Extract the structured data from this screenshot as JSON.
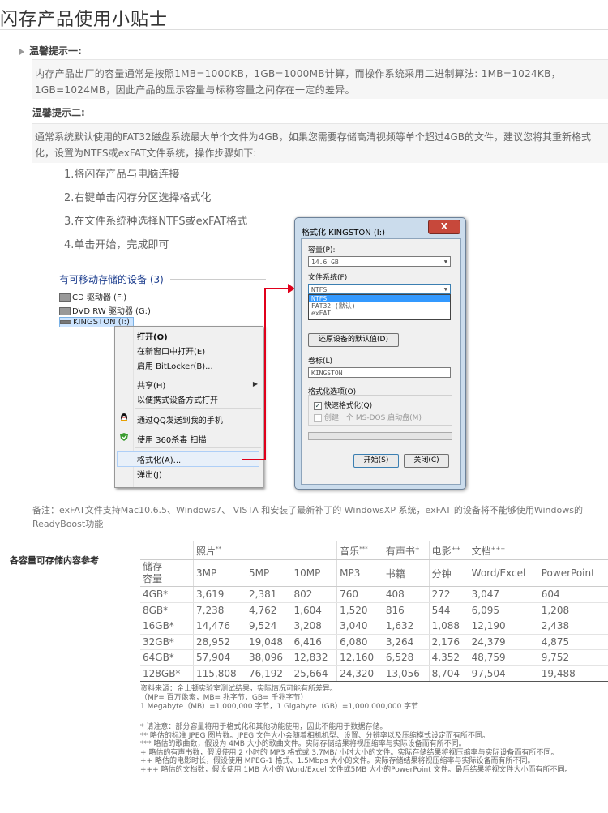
{
  "page": {
    "title": "闪存产品使用小贴士",
    "tip1_heading": "温馨提示一:",
    "tip1_text": "内存产品出厂的容量通常是按照1MB=1000KB，1GB=1000MB计算，而操作系统采用二进制算法: 1MB=1024KB，1GB=1024MB，因此产品的显示容量与标称容量之间存在一定的差异。",
    "tip2_heading": "温馨提示二:",
    "tip2_text": "通常系统默认使用的FAT32磁盘系统最大单个文件为4GB，如果您需要存储高清视频等单个超过4GB的文件，建议您将其重新格式化，设置为NTFS或exFAT文件系统，操作步骤如下:",
    "steps": [
      "1.将闪存产品与电脑连接",
      "2.右键单击闪存分区选择格式化",
      "3.在文件系统种选择NTFS或exFAT格式",
      "4.单击开始，完成即可"
    ]
  },
  "explorer": {
    "group_title": "有可移动存储的设备 (3)",
    "drives": [
      "CD 驱动器 (F:)",
      "DVD RW 驱动器 (G:)",
      "KINGSTON (I:)"
    ],
    "menu": {
      "open": "打开(O)",
      "open_new": "在新窗口中打开(E)",
      "bitlocker": "启用 BitLocker(B)...",
      "share": "共享(H)",
      "portable": "以便携式设备方式打开",
      "qq": "通过QQ发送到我的手机",
      "scan360": "使用 360杀毒 扫描",
      "format": "格式化(A)...",
      "eject": "弹出(J)"
    }
  },
  "dialog": {
    "title": "格式化 KINGSTON (I:)",
    "close": "X",
    "capacity_label": "容量(P):",
    "capacity_value": "14.6 GB",
    "fs_label": "文件系统(F)",
    "fs_value": "NTFS",
    "fs_options": [
      "NTFS",
      "FAT32 (默认)",
      "exFAT"
    ],
    "restore_button": "还原设备的默认值(D)",
    "volume_label": "卷标(L)",
    "volume_value": "KINGSTON",
    "options_label": "格式化选项(O)",
    "quick_format": "快速格式化(Q)",
    "msdos": "创建一个 MS-DOS 启动盘(M)",
    "start_button": "开始(S)",
    "close_button": "关闭(C)",
    "checkmark": "✓"
  },
  "note": "备注：exFAT文件支持Mac10.6.5、Windows7、 VISTA 和安装了最新补丁的 WindowsXP 系统，exFAT 的设备将不能够使用Windows的ReadyBoost功能",
  "chart_data": {
    "type": "table",
    "side_label": "各容量可存储内容参考",
    "group_headers": [
      {
        "label": "照片",
        "mark": "**"
      },
      {
        "label": "音乐",
        "mark": "***"
      },
      {
        "label": "有声书",
        "mark": "+"
      },
      {
        "label": "电影",
        "mark": "++"
      },
      {
        "label": "文档",
        "mark": "+++"
      }
    ],
    "unit_header": "储存容量",
    "columns": [
      "3MP",
      "5MP",
      "10MP",
      "MP3",
      "书籍",
      "分钟",
      "Word/Excel",
      "PowerPoint"
    ],
    "rows": [
      [
        "4GB*",
        "3,619",
        "2,381",
        "802",
        "760",
        "408",
        "272",
        "3,047",
        "604"
      ],
      [
        "8GB*",
        "7,238",
        "4,762",
        "1,604",
        "1,520",
        "816",
        "544",
        "6,095",
        "1,208"
      ],
      [
        "16GB*",
        "14,476",
        "9,524",
        "3,208",
        "3,040",
        "1,632",
        "1,088",
        "12,190",
        "2,438"
      ],
      [
        "32GB*",
        "28,952",
        "19,048",
        "6,416",
        "6,080",
        "3,264",
        "2,176",
        "24,379",
        "4,875"
      ],
      [
        "64GB*",
        "57,904",
        "38,096",
        "12,832",
        "12,160",
        "6,528",
        "4,352",
        "48,759",
        "9,752"
      ],
      [
        "128GB*",
        "115,808",
        "76,192",
        "25,664",
        "24,320",
        "13,056",
        "8,704",
        "97,504",
        "19,488"
      ]
    ]
  },
  "source": [
    "资料来源：金士顿实验室测试结果，实际情况可能有所差异。",
    "（MP= 百万像素，MB= 兆字节，GB= 千兆字节）",
    "1 Megabyte（MB）=1,000,000 字节，1 Gigabyte（GB）=1,000,000,000 字节"
  ],
  "footnotes": [
    "* 请注意：部分容量将用于格式化和其他功能使用，因此不能用于数据存储。",
    "** 略估的标准 JPEG 图片数。JPEG 文件大小会随着相机机型、设置、分辨率以及压缩模式设定而有所不同。",
    "*** 略估的歌曲数，假设为 4MB 大小的歌曲文件。实际存储结果将视压缩率与实际设备而有所不同。",
    "+ 略估的有声书数，假设使用 2 小时的 MP3 格式或 3.7MB/ 小时大小的文件。实际存储结果将视压缩率与实际设备而有所不同。",
    "++ 略估的电影时长，假设使用 MPEG-1 格式、1.5Mbps 大小的文件。实际存储结果将视压缩率与实际设备而有所不同。",
    "+++ 略估的文档数，假设使用 1MB 大小的 Word/Excel 文件或5MB 大小的PowerPoint 文件。最后结果将视文件大小而有所不同。"
  ]
}
